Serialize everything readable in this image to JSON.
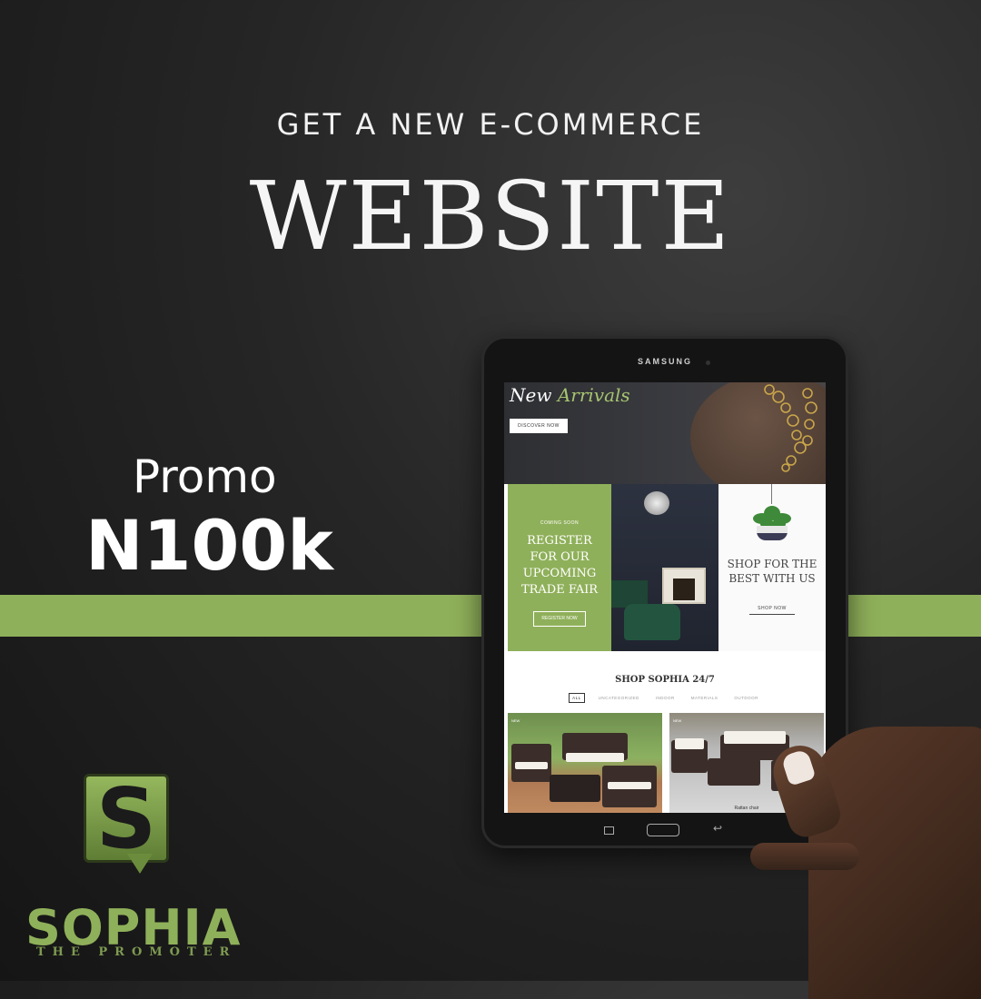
{
  "headline": {
    "top": "GET A NEW E-COMMERCE",
    "main": "WEBSITE"
  },
  "promo": {
    "label": "Promo",
    "price": "N100k"
  },
  "logo": {
    "letter": "S",
    "name": "SOPHIA",
    "tagline": "THE PROMOTER"
  },
  "device": {
    "brand": "SAMSUNG"
  },
  "site": {
    "hero": {
      "title_1": "New",
      "title_2": "Arrivals",
      "button": "DISCOVER NOW"
    },
    "fair": {
      "kicker": "COMING SOON",
      "title": "REGISTER FOR OUR UPCOMING TRADE FAIR",
      "button": "REGISTER NOW"
    },
    "shop": {
      "title": "SHOP FOR THE BEST WITH US",
      "button": "SHOP NOW"
    },
    "catalog": {
      "title": "SHOP SOPHIA 24/7",
      "tabs": [
        "ALL",
        "UNCATEGORIZED",
        "INDOOR",
        "MATERIALS",
        "OUTDOOR"
      ],
      "active_tab": "ALL",
      "products": [
        {
          "badge": "NEW",
          "label": ""
        },
        {
          "badge": "NEW",
          "label": "Rattan chair"
        }
      ]
    }
  },
  "colors": {
    "accent_green": "#8fb05a",
    "background": "#262626"
  }
}
